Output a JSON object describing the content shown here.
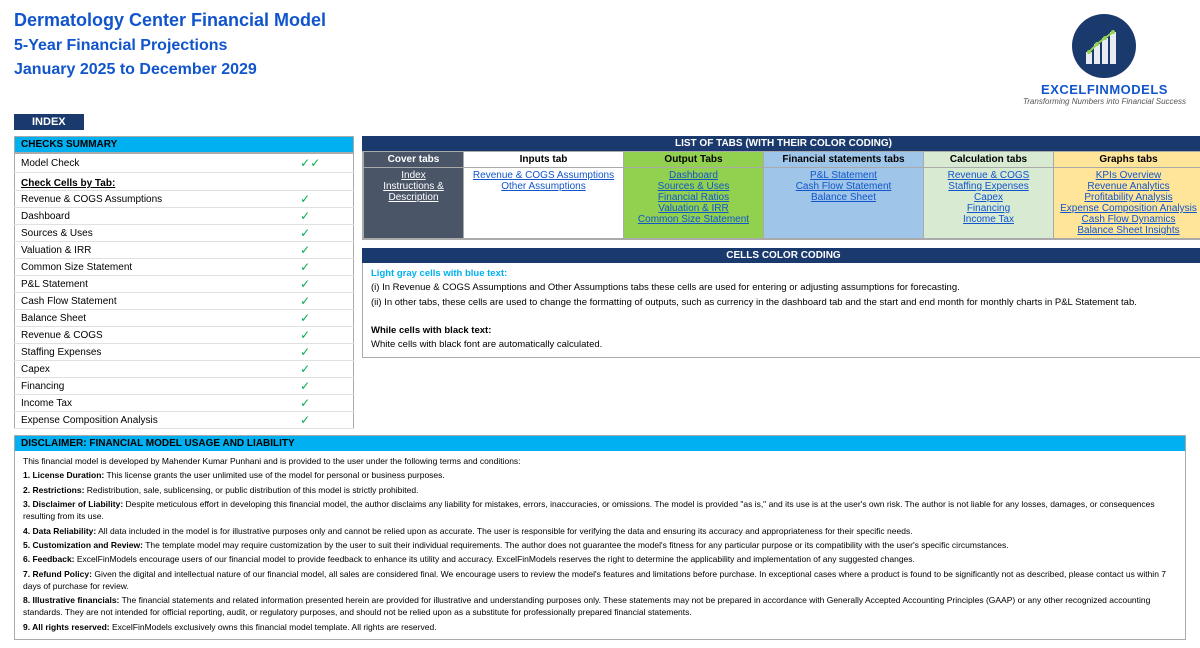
{
  "header": {
    "title1": "Dermatology Center Financial Model",
    "title2": "5-Year Financial Projections",
    "title3": "January 2025 to December 2029",
    "index_label": "INDEX"
  },
  "logo": {
    "name": "EXCELFINMODELS",
    "tagline": "Transforming Numbers into Financial Success"
  },
  "checks_summary": {
    "header": "CHECKS  SUMMARY",
    "model_check_label": "Model Check",
    "double_check": "✓✓",
    "check_cells_label": "Check Cells by Tab:",
    "items": [
      {
        "label": "Revenue & COGS Assumptions",
        "check": "✓"
      },
      {
        "label": "Dashboard",
        "check": "✓"
      },
      {
        "label": "Sources & Uses",
        "check": "✓"
      },
      {
        "label": "Valuation & IRR",
        "check": "✓"
      },
      {
        "label": "Common Size Statement",
        "check": "✓"
      },
      {
        "label": "P&L Statement",
        "check": "✓"
      },
      {
        "label": "Cash Flow Statement",
        "check": "✓"
      },
      {
        "label": "Balance Sheet",
        "check": "✓"
      },
      {
        "label": "Revenue & COGS",
        "check": "✓"
      },
      {
        "label": "Staffing Expenses",
        "check": "✓"
      },
      {
        "label": "Capex",
        "check": "✓"
      },
      {
        "label": "Financing",
        "check": "✓"
      },
      {
        "label": "Income Tax",
        "check": "✓"
      },
      {
        "label": "Expense Composition Analysis",
        "check": "✓"
      }
    ]
  },
  "tabs_section": {
    "header": "LIST OF TABS (WITH THEIR COLOR CODING)",
    "columns": [
      {
        "header": "Cover tabs",
        "type": "cover",
        "items": [
          "Index",
          "Instructions & Description"
        ]
      },
      {
        "header": "Inputs tab",
        "type": "inputs",
        "items": [
          "Revenue & COGS Assumptions",
          "Other Assumptions"
        ]
      },
      {
        "header": "Output Tabs",
        "type": "output",
        "items": [
          "Dashboard",
          "Sources & Uses",
          "Financial Ratios",
          "Valuation & IRR",
          "Common Size Statement"
        ]
      },
      {
        "header": "Financial statements tabs",
        "type": "financial",
        "items": [
          "P&L Statement",
          "Cash Flow Statement",
          "Balance Sheet"
        ]
      },
      {
        "header": "Calculation tabs",
        "type": "calculation",
        "items": [
          "Revenue & COGS",
          "Staffing Expenses",
          "Capex",
          "Financing",
          "Income Tax"
        ]
      },
      {
        "header": "Graphs tabs",
        "type": "graphs",
        "items": [
          "KPIs Overview",
          "Revenue Analytics",
          "Profitability Analysis",
          "Expense Composition Analysis",
          "Cash Flow Dynamics",
          "Balance Sheet Insights"
        ]
      }
    ]
  },
  "cells_coding": {
    "header": "CELLS COLOR CODING",
    "light_gray_label": "Light gray cells with blue text:",
    "light_gray_text1": "(i) In Revenue & COGS Assumptions and Other Assumptions tabs these cells are used for entering or adjusting assumptions for forecasting.",
    "light_gray_text2": "(ii) In other tabs, these cells are used to change the formatting of outputs, such as currency in the dashboard tab and the start and end month for monthly charts in P&L Statement tab.",
    "white_label": "While cells with black text:",
    "white_text": "White cells with black font are automatically calculated."
  },
  "disclaimer": {
    "header": "DISCLAIMER: FINANCIAL MODEL USAGE AND LIABILITY",
    "intro": "This financial model  is developed by Mahender Kumar Punhani and is provided to the user under the following terms and conditions:",
    "items": [
      {
        "num": "1.",
        "label": "License Duration:",
        "text": "This license grants the user unlimited use of the model for personal or business purposes."
      },
      {
        "num": "2.",
        "label": "Restrictions:",
        "text": "Redistribution, sale, sublicensing, or public distribution of this model is strictly prohibited."
      },
      {
        "num": "3.",
        "label": "Disclaimer of Liability:",
        "text": "Despite meticulous effort in developing this financial model, the author disclaims any liability for mistakes, errors, inaccuracies, or omissions. The model is provided \"as is,\" and its use is at the user's own risk. The author is  not liable for any  losses, damages, or consequences resulting from its use."
      },
      {
        "num": "4.",
        "label": "Data Reliability:",
        "text": "All data included in the model is for illustrative purposes only and cannot be relied upon as accurate. The user is  responsible for verifying the data and ensuring its accuracy and appropriateness for their specific needs."
      },
      {
        "num": "5.",
        "label": "Customization and Review:",
        "text": "The template model may require customization by the user to suit their individual requirements. The author does not guarantee the model's fitness for any  particular purpose or its compatibility with the user's specific circumstances."
      },
      {
        "num": "6.",
        "label": "Feedback:",
        "text": "ExcelFinModels encourage users of our financial model to provide feedback to enhance its utility and accuracy. ExcelFinModels reserves the right to determine the applicability and implementation of any suggested changes."
      },
      {
        "num": "7.",
        "label": "Refund Policy:",
        "text": "Given the digital and intellectual nature of our financial model, all sales are considered final. We encourage users to review the model's features and limitations before purchase. In exceptional cases where a product is found to be  significantly not as described, please contact us within 7 days of purchase for review."
      },
      {
        "num": "8.",
        "label": "Illustrative financials:",
        "text": "The financial statements and related information presented herein are provided for illustrative and understanding purposes only. These statements may not be prepared in accordance with Generally Accepted Accounting Principles (GAAP) or any other recognized accounting standards. They are not intended for official reporting, audit, or regulatory purposes, and should not be relied upon as a substitute for professionally prepared financial statements."
      },
      {
        "num": "9.",
        "label": "All rights reserved:",
        "text": "ExcelFinModels exclusively owns this financial model template. All rights are reserved."
      }
    ]
  }
}
